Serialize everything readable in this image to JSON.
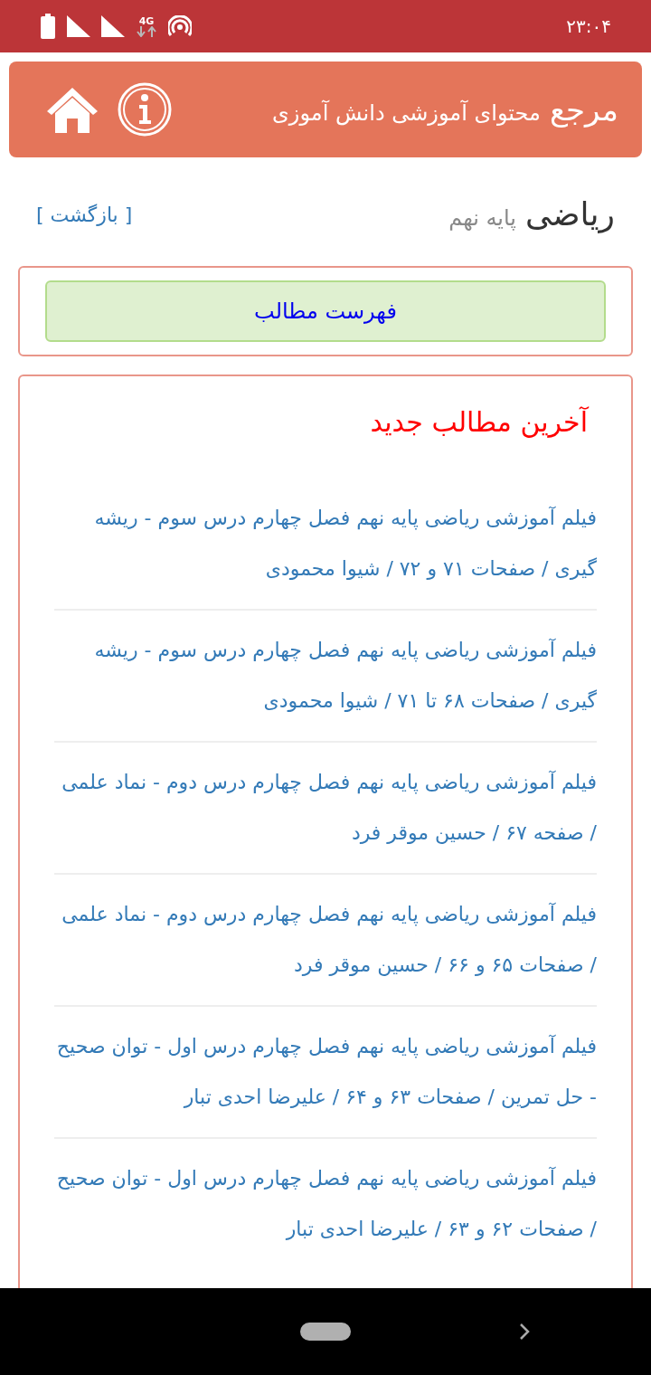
{
  "status_bar": {
    "network": "4G",
    "time": "۲۳:۰۴"
  },
  "header": {
    "title": "مرجع",
    "subtitle": "محتوای آموزشی دانش آموزی"
  },
  "page": {
    "subject": "ریاضی",
    "grade": "پایه نهم",
    "back_link": "[ بازگشت ]"
  },
  "toc_button": "فهرست مطالب",
  "latest": {
    "heading": "آخرین مطالب جدید",
    "items": [
      "فیلم آموزشی ریاضی پایه نهم فصل چهارم درس سوم - ریشه گیری / صفحات ۷۱ و ۷۲ / شیوا محمودی",
      "فیلم آموزشی ریاضی پایه نهم فصل چهارم درس سوم - ریشه گیری / صفحات ۶۸ تا ۷۱ / شیوا محمودی",
      "فیلم آموزشی ریاضی پایه نهم فصل چهارم درس دوم - نماد علمی / صفحه ۶۷ / حسین موقر فرد",
      "فیلم آموزشی ریاضی پایه نهم فصل چهارم درس دوم - نماد علمی / صفحات ۶۵ و ۶۶ / حسین موقر فرد",
      "فیلم آموزشی ریاضی پایه نهم فصل چهارم درس اول - توان صحیح - حل تمرین / صفحات ۶۳ و ۶۴ / علیرضا احدی تبار",
      "فیلم آموزشی ریاضی پایه نهم فصل چهارم درس اول - توان صحیح / صفحات ۶۲ و ۶۳ / علیرضا احدی تبار"
    ]
  }
}
